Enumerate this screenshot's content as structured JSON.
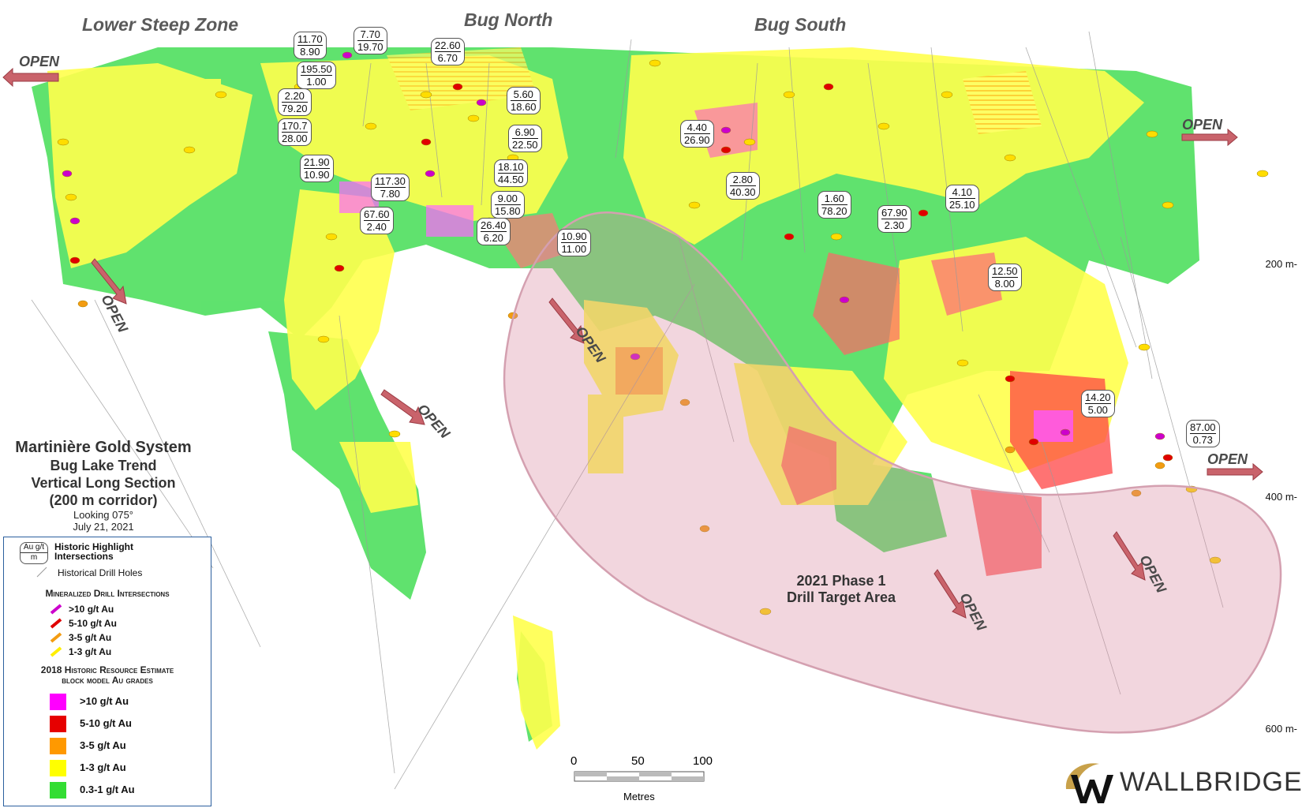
{
  "zones": {
    "lower_steep": "Lower Steep Zone",
    "bug_north": "Bug North",
    "bug_south": "Bug South"
  },
  "open_label": "OPEN",
  "callouts": [
    {
      "au": "11.70",
      "m": "8.90"
    },
    {
      "au": "7.70",
      "m": "19.70"
    },
    {
      "au": "22.60",
      "m": "6.70"
    },
    {
      "au": "195.50",
      "m": "1.00"
    },
    {
      "au": "2.20",
      "m": "79.20"
    },
    {
      "au": "5.60",
      "m": "18.60"
    },
    {
      "au": "170.7",
      "m": "28.00"
    },
    {
      "au": "6.90",
      "m": "22.50"
    },
    {
      "au": "21.90",
      "m": "10.90"
    },
    {
      "au": "18.10",
      "m": "44.50"
    },
    {
      "au": "117.30",
      "m": "7.80"
    },
    {
      "au": "9.00",
      "m": "15.80"
    },
    {
      "au": "67.60",
      "m": "2.40"
    },
    {
      "au": "26.40",
      "m": "6.20"
    },
    {
      "au": "10.90",
      "m": "11.00"
    },
    {
      "au": "4.40",
      "m": "26.90"
    },
    {
      "au": "2.80",
      "m": "40.30"
    },
    {
      "au": "1.60",
      "m": "78.20"
    },
    {
      "au": "67.90",
      "m": "2.30"
    },
    {
      "au": "4.10",
      "m": "25.10"
    },
    {
      "au": "12.50",
      "m": "8.00"
    },
    {
      "au": "14.20",
      "m": "5.00"
    },
    {
      "au": "87.00",
      "m": "0.73"
    }
  ],
  "depth_labels": [
    "200 m-",
    "400 m-",
    "600 m-"
  ],
  "section_title": {
    "line1": "Martinière Gold System",
    "line2": "Bug Lake Trend",
    "line3": "Vertical Long Section",
    "line4": "(200 m corridor)",
    "line5": "Looking 075°",
    "line6": "July 21, 2021"
  },
  "legend": {
    "box_top": "Au g/t",
    "box_bottom": "m",
    "historic_highlight": "Historic Highlight Intersections",
    "historical_holes": "Historical Drill Holes",
    "mineralized_header": "Mineralized Drill Intersections",
    "intersections": [
      {
        "label": ">10 g/t Au",
        "color": "#cc00cc"
      },
      {
        "label": "5-10 g/t Au",
        "color": "#e00000"
      },
      {
        "label": "3-5 g/t Au",
        "color": "#f39c12"
      },
      {
        "label": "1-3 g/t Au",
        "color": "#ffee00"
      }
    ],
    "resource_header_1": "2018 Historic Resource Estimate",
    "resource_header_2": "block model Au grades",
    "blocks": [
      {
        "label": ">10 g/t Au",
        "color": "#ff00ff"
      },
      {
        "label": "5-10 g/t Au",
        "color": "#e60000"
      },
      {
        "label": "3-5 g/t Au",
        "color": "#ff9900"
      },
      {
        "label": "1-3 g/t Au",
        "color": "#ffff00"
      },
      {
        "label": "0.3-1 g/t Au",
        "color": "#33dd33"
      }
    ]
  },
  "target_area": {
    "line1": "2021 Phase 1",
    "line2": "Drill Target Area"
  },
  "scale": {
    "ticks": [
      "0",
      "50",
      "100"
    ],
    "unit": "Metres"
  },
  "logo_text": "WALLBRIDGE"
}
